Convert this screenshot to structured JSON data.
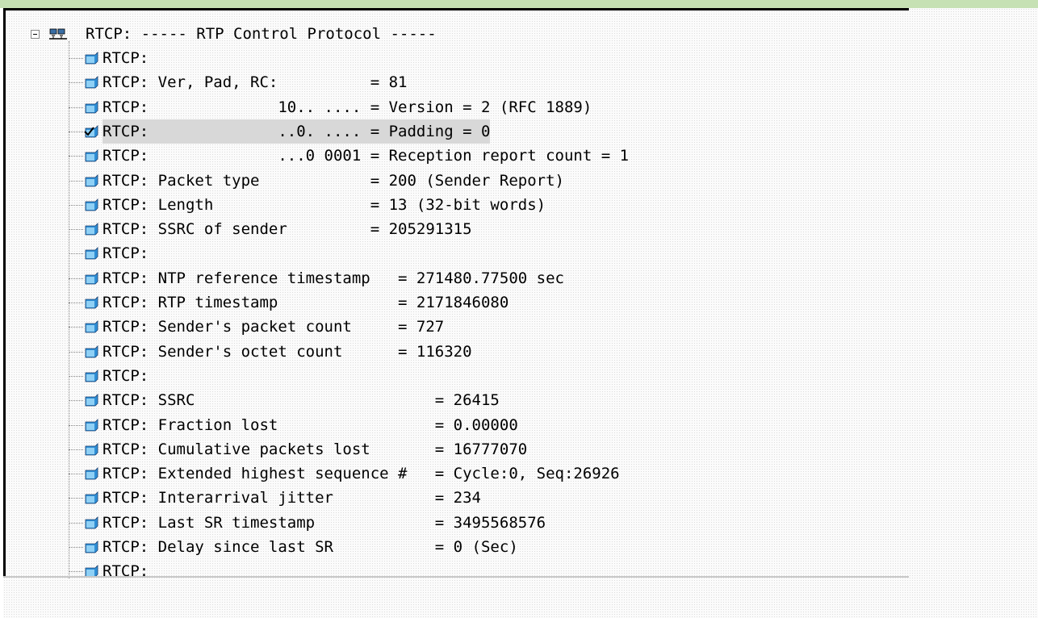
{
  "window": {
    "accent": "#c6e1b4"
  },
  "tree": {
    "root_label": "RTCP: ----- RTP Control Protocol -----",
    "root_icon": "network-protocol-icon",
    "node_icon": "packet-field-icon",
    "checked_icon": "checked-field-icon",
    "rows": [
      "RTCP:",
      "RTCP: Ver, Pad, RC:          = 81",
      "RTCP:              10.. .... = Version = 2 (RFC 1889)",
      "RTCP:              ..0. .... = Padding = 0",
      "RTCP:              ...0 0001 = Reception report count = 1",
      "RTCP: Packet type            = 200 (Sender Report)",
      "RTCP: Length                 = 13 (32-bit words)",
      "RTCP: SSRC of sender         = 205291315",
      "RTCP:",
      "RTCP: NTP reference timestamp   = 271480.77500 sec",
      "RTCP: RTP timestamp             = 2171846080",
      "RTCP: Sender's packet count     = 727",
      "RTCP: Sender's octet count      = 116320",
      "RTCP:",
      "RTCP: SSRC                          = 26415",
      "RTCP: Fraction lost                 = 0.00000",
      "RTCP: Cumulative packets lost       = 16777070",
      "RTCP: Extended highest sequence #   = Cycle:0, Seq:26926",
      "RTCP: Interarrival jitter           = 234",
      "RTCP: Last SR timestamp             = 3495568576",
      "RTCP: Delay since last SR           = 0 (Sec)",
      "RTCP:"
    ],
    "selected_index": 3
  }
}
